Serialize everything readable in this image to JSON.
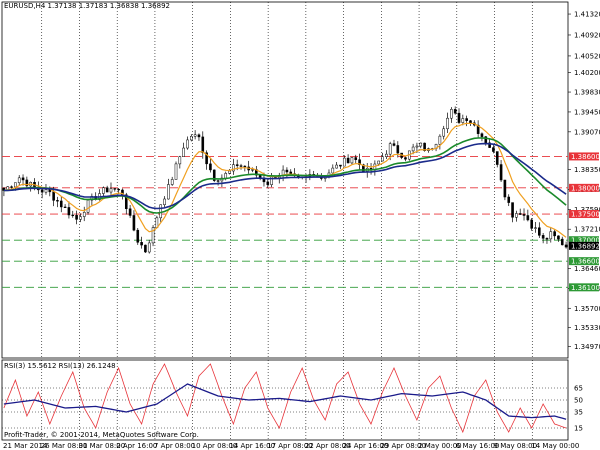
{
  "chart_data": [
    {
      "type": "candlestick",
      "header": "EURUSD,H4  1.37138 1.37183 1.36838 1.36892",
      "symbol": "EURUSD",
      "timeframe": "H4",
      "ohlc_readout": {
        "open": 1.37138,
        "high": 1.37183,
        "low": 1.36838,
        "close": 1.36892
      },
      "ylim": [
        1.3475,
        1.4155
      ],
      "y_ticks": [
        "1.41320",
        "1.40920",
        "1.40520",
        "1.40200",
        "1.39830",
        "1.39450",
        "1.39070",
        "1.38350",
        "1.37970",
        "1.37590",
        "1.37210",
        "1.36460",
        "1.36080",
        "1.35700",
        "1.35330",
        "1.34970"
      ],
      "horizontal_levels": [
        {
          "label": "1.38600",
          "value": 1.386,
          "color": "#e8343a",
          "role": "resistance"
        },
        {
          "label": "1.38000",
          "value": 1.38,
          "color": "#e8343a",
          "role": "resistance"
        },
        {
          "label": "1.37500",
          "value": 1.375,
          "color": "#e8343a",
          "role": "resistance"
        },
        {
          "label": "1.37000",
          "value": 1.37,
          "color": "#2e9a36",
          "role": "support"
        },
        {
          "label": "1.36600",
          "value": 1.366,
          "color": "#2e9a36",
          "role": "support"
        },
        {
          "label": "1.36100",
          "value": 1.361,
          "color": "#2e9a36",
          "role": "support"
        }
      ],
      "current_price": {
        "label": "1.36892",
        "value": 1.36892
      },
      "x_labels": [
        "21 Mar 2014",
        "26 Mar 08:00",
        "31 Mar 08:00",
        "2 Apr 16:00",
        "7 Apr 08:00",
        "10 Apr 08:00",
        "14 Apr 16:00",
        "17 Apr 08:00",
        "22 Apr 08:00",
        "24 Apr 16:00",
        "29 Apr 08:00",
        "2 May 00:00",
        "6 May 16:00",
        "9 May 08:00",
        "14 May 00:00"
      ],
      "price_path": [
        [
          0,
          1.3795
        ],
        [
          4,
          1.382
        ],
        [
          8,
          1.38
        ],
        [
          12,
          1.379
        ],
        [
          16,
          1.376
        ],
        [
          19,
          1.374
        ],
        [
          22,
          1.377
        ],
        [
          25,
          1.379
        ],
        [
          28,
          1.38
        ],
        [
          31,
          1.379
        ],
        [
          33,
          1.374
        ],
        [
          35,
          1.37
        ],
        [
          37,
          1.368
        ],
        [
          39,
          1.372
        ],
        [
          41,
          1.377
        ],
        [
          43,
          1.38
        ],
        [
          45,
          1.384
        ],
        [
          47,
          1.388
        ],
        [
          49,
          1.39
        ],
        [
          51,
          1.3895
        ],
        [
          53,
          1.385
        ],
        [
          55,
          1.382
        ],
        [
          57,
          1.382
        ],
        [
          59,
          1.383
        ],
        [
          61,
          1.3845
        ],
        [
          63,
          1.384
        ],
        [
          65,
          1.383
        ],
        [
          67,
          1.382
        ],
        [
          69,
          1.381
        ],
        [
          71,
          1.3825
        ],
        [
          73,
          1.383
        ],
        [
          75,
          1.382
        ],
        [
          77,
          1.3815
        ],
        [
          79,
          1.382
        ],
        [
          81,
          1.383
        ],
        [
          83,
          1.382
        ],
        [
          85,
          1.383
        ],
        [
          87,
          1.384
        ],
        [
          89,
          1.385
        ],
        [
          91,
          1.386
        ],
        [
          93,
          1.3845
        ],
        [
          95,
          1.383
        ],
        [
          97,
          1.384
        ],
        [
          99,
          1.386
        ],
        [
          101,
          1.388
        ],
        [
          103,
          1.387
        ],
        [
          105,
          1.386
        ],
        [
          107,
          1.3875
        ],
        [
          109,
          1.388
        ],
        [
          111,
          1.387
        ],
        [
          113,
          1.389
        ],
        [
          115,
          1.392
        ],
        [
          117,
          1.3945
        ],
        [
          119,
          1.393
        ],
        [
          121,
          1.3935
        ],
        [
          123,
          1.392
        ],
        [
          125,
          1.39
        ],
        [
          127,
          1.388
        ],
        [
          129,
          1.385
        ],
        [
          131,
          1.379
        ],
        [
          133,
          1.375
        ],
        [
          135,
          1.3755
        ],
        [
          137,
          1.374
        ],
        [
          139,
          1.372
        ],
        [
          141,
          1.37
        ],
        [
          143,
          1.371
        ],
        [
          145,
          1.37
        ],
        [
          147,
          1.3689
        ]
      ],
      "moving_averages": [
        {
          "color": "#f0a020",
          "period": "fast"
        },
        {
          "color": "#1a8a2a",
          "period": "medium"
        },
        {
          "color": "#1a2a8a",
          "period": "slow"
        }
      ],
      "candle_colors": {
        "body": "#000000",
        "wick": "#000000"
      }
    },
    {
      "type": "line",
      "header": "RSI(3) 15.5612  RSI(13) 26.1248",
      "series": [
        {
          "name": "RSI(3)",
          "last": 15.5612,
          "color": "#e8343a"
        },
        {
          "name": "RSI(13)",
          "last": 26.1248,
          "color": "#1a1a8a"
        }
      ],
      "ylim": [
        0,
        100
      ],
      "y_ticks": [
        "65",
        "50",
        "35",
        "15"
      ],
      "levels": [
        65,
        50,
        35,
        15
      ],
      "rsi3_path": [
        [
          0,
          40
        ],
        [
          3,
          75
        ],
        [
          6,
          30
        ],
        [
          9,
          60
        ],
        [
          12,
          20
        ],
        [
          15,
          55
        ],
        [
          18,
          85
        ],
        [
          21,
          40
        ],
        [
          24,
          15
        ],
        [
          27,
          60
        ],
        [
          30,
          90
        ],
        [
          33,
          45
        ],
        [
          36,
          20
        ],
        [
          39,
          70
        ],
        [
          42,
          95
        ],
        [
          45,
          60
        ],
        [
          48,
          30
        ],
        [
          51,
          80
        ],
        [
          54,
          95
        ],
        [
          57,
          55
        ],
        [
          60,
          20
        ],
        [
          63,
          65
        ],
        [
          66,
          85
        ],
        [
          69,
          40
        ],
        [
          72,
          15
        ],
        [
          75,
          60
        ],
        [
          78,
          90
        ],
        [
          81,
          50
        ],
        [
          84,
          25
        ],
        [
          87,
          70
        ],
        [
          90,
          85
        ],
        [
          93,
          45
        ],
        [
          96,
          20
        ],
        [
          99,
          60
        ],
        [
          102,
          90
        ],
        [
          105,
          55
        ],
        [
          108,
          25
        ],
        [
          111,
          65
        ],
        [
          114,
          80
        ],
        [
          117,
          40
        ],
        [
          120,
          10
        ],
        [
          123,
          55
        ],
        [
          126,
          75
        ],
        [
          129,
          35
        ],
        [
          132,
          10
        ],
        [
          135,
          40
        ],
        [
          138,
          15
        ],
        [
          141,
          45
        ],
        [
          144,
          20
        ],
        [
          147,
          15
        ]
      ],
      "rsi13_path": [
        [
          0,
          45
        ],
        [
          8,
          50
        ],
        [
          16,
          40
        ],
        [
          24,
          42
        ],
        [
          32,
          35
        ],
        [
          40,
          45
        ],
        [
          48,
          70
        ],
        [
          56,
          55
        ],
        [
          64,
          50
        ],
        [
          72,
          52
        ],
        [
          80,
          48
        ],
        [
          88,
          55
        ],
        [
          96,
          50
        ],
        [
          104,
          58
        ],
        [
          112,
          55
        ],
        [
          120,
          60
        ],
        [
          126,
          50
        ],
        [
          132,
          30
        ],
        [
          138,
          28
        ],
        [
          144,
          30
        ],
        [
          147,
          26
        ]
      ],
      "copyright": "Profit-Trader, © 2001-2014, MetaQuotes Software Corp."
    }
  ],
  "colors": {
    "background": "#ffffff",
    "grid": "#000000",
    "resistance": "#e8343a",
    "support": "#2e9a36",
    "current_price_tag": "#000000"
  }
}
